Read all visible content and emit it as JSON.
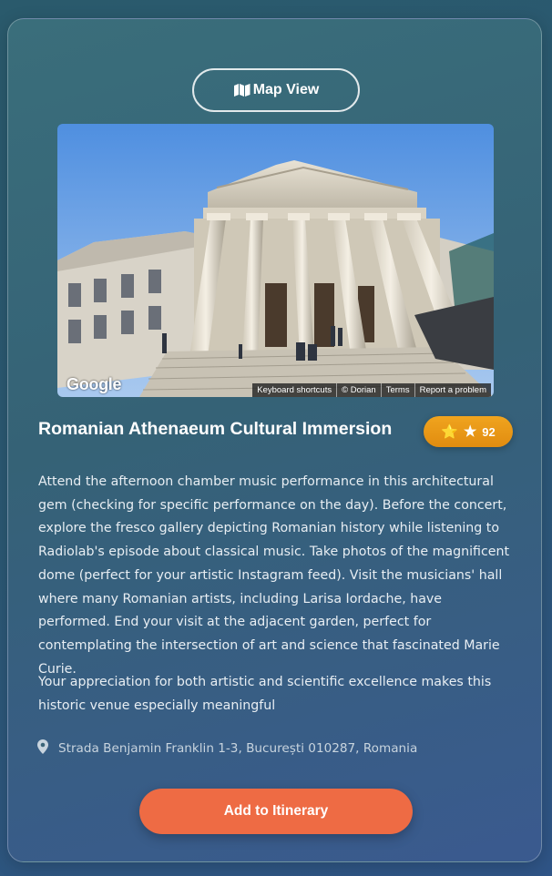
{
  "map_button": {
    "label": "Map View",
    "icon": "map-icon"
  },
  "photo": {
    "google_logo": "Google",
    "attribution": [
      "Keyboard shortcuts",
      "© Dorian",
      "Terms",
      "Report a problem"
    ]
  },
  "place": {
    "title": "Romanian Athenaeum Cultural Immersion",
    "rating_emoji": "⭐",
    "rating_star": "★",
    "rating_value": "92",
    "description": "Attend the afternoon chamber music performance in this architectural gem (checking for specific performance on the day). Before the concert, explore the fresco gallery depicting Romanian history while listening to Radiolab's episode about classical music. Take photos of the magnificent dome (perfect for your artistic Instagram feed). Visit the musicians' hall where many Romanian artists, including Larisa Iordache, have performed. End your visit at the adjacent garden, perfect for contemplating the intersection of art and science that fascinated Marie Curie.",
    "note": "Your appreciation for both artistic and scientific excellence makes this historic venue especially meaningful",
    "address": "Strada Benjamin Franklin 1-3, București 010287, Romania"
  },
  "add_button": {
    "label": "Add to Itinerary"
  },
  "colors": {
    "accent_button": "#ee6b44",
    "rating_badge": "#e9981a"
  }
}
